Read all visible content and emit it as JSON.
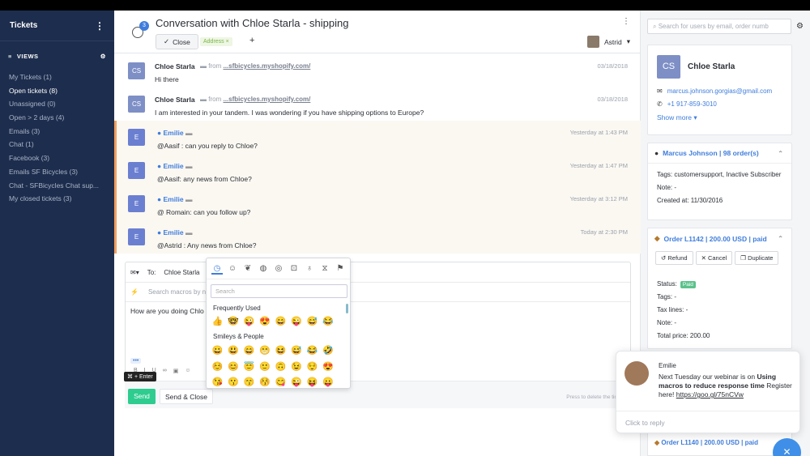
{
  "sidebar": {
    "title": "Tickets",
    "views_label": "VIEWS",
    "items": [
      {
        "label": "My Tickets (1)"
      },
      {
        "label": "Open tickets (8)"
      },
      {
        "label": "Unassigned (0)"
      },
      {
        "label": "Open > 2 days (4)"
      },
      {
        "label": "Emails (3)"
      },
      {
        "label": "Chat (1)"
      },
      {
        "label": "Facebook (3)"
      },
      {
        "label": "Emails SF Bicycles (3)"
      },
      {
        "label": "Chat - SFBicycles Chat sup..."
      },
      {
        "label": "My closed tickets (3)"
      }
    ]
  },
  "header": {
    "history_count": "3",
    "title": "Conversation with Chloe Starla - shipping",
    "close_label": "Close",
    "tag": "Address ×",
    "add": "+",
    "agent": "Astrid"
  },
  "messages": [
    {
      "avatar": "CS",
      "name": "Chloe Starla",
      "from": "from",
      "source": "...sfbicycles.myshopify.com/",
      "time": "03/18/2018",
      "body": "Hi there",
      "internal": false
    },
    {
      "avatar": "CS",
      "name": "Chloe Starla",
      "from": "from",
      "source": "...sfbicycles.myshopify.com/",
      "time": "03/18/2018",
      "body": "I am interested in your tandem. I was wondering if you have shipping options to Europe?",
      "internal": false
    },
    {
      "avatar": "E",
      "name": "Emilie",
      "time": "Yesterday at 1:43 PM",
      "body": "@Aasif : can you reply to Chloe?",
      "internal": true
    },
    {
      "avatar": "E",
      "name": "Emilie",
      "time": "Yesterday at 1:47 PM",
      "body": "@Aasif: any news from Chloe?",
      "internal": true
    },
    {
      "avatar": "E",
      "name": "Emilie",
      "time": "Yesterday at 3:12 PM",
      "body": "@ Romain: can you follow up?",
      "internal": true
    },
    {
      "avatar": "E",
      "name": "Emilie",
      "time": "Today at 2:30 PM",
      "body": "@Astrid : Any news from Chloe?",
      "internal": true
    }
  ],
  "composer": {
    "to_label": "To:",
    "to_value": "Chloe Starla",
    "macros_placeholder": "Search macros by n",
    "text": "How are you doing Chlo",
    "more": "•••",
    "shortcut": "⌘ + Enter",
    "send": "Send",
    "send_close": "Send & Close",
    "hint": "Press  to delete the tick"
  },
  "emoji_picker": {
    "search_placeholder": "Search",
    "section1": "Frequently Used",
    "section2": "Smileys & People",
    "frequent": [
      "👍",
      "🤓",
      "😜",
      "😍",
      "😄",
      "😜",
      "😅",
      "😂"
    ],
    "smileys1": [
      "😀",
      "😃",
      "😄",
      "😁",
      "😆",
      "😅",
      "😂",
      "🤣"
    ],
    "smileys2": [
      "☺️",
      "😊",
      "😇",
      "🙂",
      "🙃",
      "😉",
      "😌",
      "😍"
    ],
    "smileys3": [
      "😘",
      "😗",
      "😙",
      "😚",
      "😋",
      "😜",
      "😝",
      "😛"
    ]
  },
  "right": {
    "search_placeholder": "Search for users by email, order numb",
    "customer": {
      "initials": "CS",
      "name": "Chloe Starla",
      "email": "marcus.johnson.gorgias@gmail.com",
      "phone": "+1 917-859-3010",
      "show_more": "Show more"
    },
    "shopify": {
      "header": "Marcus Johnson | 98 order(s)",
      "tags": "Tags:  customersupport, Inactive Subscriber",
      "note": "Note:  -",
      "created": "Created at:  11/30/2016"
    },
    "order": {
      "header": "Order L1142 | 200.00 USD | paid",
      "refund": "Refund",
      "cancel": "Cancel",
      "duplicate": "Duplicate",
      "status_label": "Status:",
      "status_badge": "Paid",
      "tags": "Tags:  -",
      "tax": "Tax lines:  -",
      "note": "Note:  -",
      "total": "Total price:  200.00"
    },
    "last_order": "Order L1140 | 200.00 USD | paid"
  },
  "toast": {
    "name": "Emilie",
    "body_pre": "Next Tuesday our webinar is on ",
    "body_bold": "Using macros to reduce response time",
    "body_post": " Register here! ",
    "link": "https://goo.gl/75nCVw",
    "reply": "Click to reply"
  }
}
